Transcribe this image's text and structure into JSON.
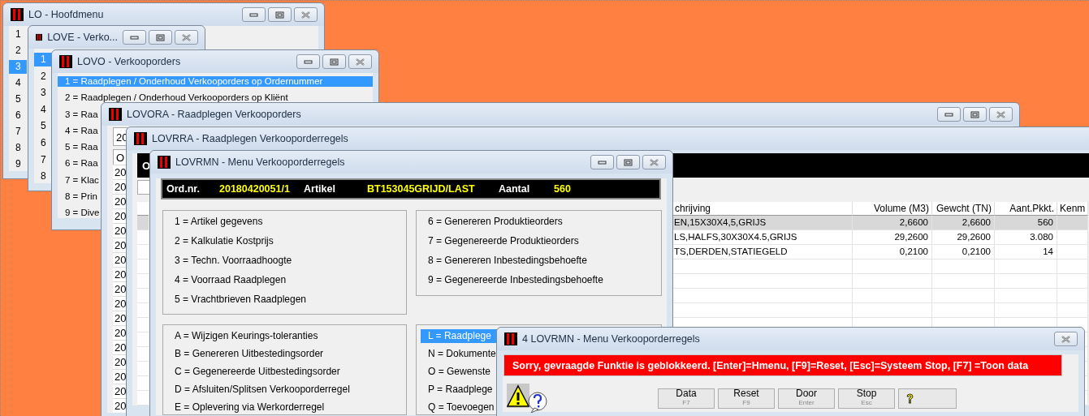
{
  "windows": [
    {
      "kind": "list",
      "title": "LO - Hoofdmenu",
      "items": [
        {
          "label": "1",
          "selected": false
        },
        {
          "label": "2",
          "selected": false
        },
        {
          "label": "3",
          "selected": true
        },
        {
          "label": "4",
          "selected": false
        },
        {
          "label": "5",
          "selected": false
        },
        {
          "label": "6",
          "selected": false
        },
        {
          "label": "7",
          "selected": false
        },
        {
          "label": "8",
          "selected": false
        },
        {
          "label": "9",
          "selected": false
        }
      ]
    },
    {
      "kind": "list",
      "title": "LOVE - Verko...",
      "items": [
        {
          "label": "1",
          "selected": true
        },
        {
          "label": "2",
          "selected": false
        },
        {
          "label": "3",
          "selected": false
        },
        {
          "label": "4",
          "selected": false
        },
        {
          "label": "5",
          "selected": false
        },
        {
          "label": "6",
          "selected": false
        },
        {
          "label": "7",
          "selected": false
        },
        {
          "label": "8",
          "selected": false
        }
      ]
    },
    {
      "kind": "list",
      "title": "LOVO - Verkooporders",
      "items": [
        {
          "label": "1 = Raadplegen / Onderhoud Verkooporders op Ordernummer",
          "selected": true
        },
        {
          "label": "2 = Raadplegen / Onderhoud Verkooporders op Kliënt",
          "selected": false
        },
        {
          "label": "3 = Raa",
          "selected": false
        },
        {
          "label": "4 = Raa",
          "selected": false
        },
        {
          "label": "5 = Raa",
          "selected": false
        },
        {
          "label": "6 = Raa",
          "selected": false
        },
        {
          "label": "7 = Klac",
          "selected": false
        },
        {
          "label": "8 = Prin",
          "selected": false
        },
        {
          "label": "9 = Dive",
          "selected": false
        }
      ]
    },
    {
      "kind": "orders",
      "title": "LOVORA - Raadplegen Verkooporders",
      "field_value": "20",
      "column_1": "O",
      "rows": [
        "20",
        "20",
        "20",
        "20",
        "20",
        "20",
        "20",
        "20",
        "20",
        "20",
        "20",
        "20",
        "20",
        "20",
        "20",
        "20",
        "20"
      ]
    },
    {
      "kind": "lines",
      "title": "LOVRRA - Raadplegen Verkooporderregels",
      "header_bar": "O",
      "columns": [
        "chrijving",
        "Volume (M3)",
        "Gewcht (TN)",
        "Aant.Pkkt.",
        "Kenm"
      ],
      "rows": [
        {
          "cells": [
            "EN,15X30X4,5,GRIJS",
            "2,6600",
            "2,6600",
            "560"
          ],
          "selected": true
        },
        {
          "cells": [
            "LS,HALFS,30X30X4.5,GRIJS",
            "29,2600",
            "29,2600",
            "3.080"
          ],
          "selected": false
        },
        {
          "cells": [
            "TS,DERDEN,STATIEGELD",
            "0,2100",
            "0,2100",
            "14"
          ],
          "selected": false
        }
      ]
    },
    {
      "kind": "menu",
      "title": "LOVRMN - Menu Verkooporderregels",
      "info": [
        {
          "label": "Ord.nr.",
          "value": "20180420051/1"
        },
        {
          "label": "Artikel",
          "value": "BT153045GRIJD/LAST"
        },
        {
          "label": "Aantal",
          "value": "560"
        }
      ],
      "groups": [
        {
          "items": [
            {
              "label": "1 = Artikel gegevens",
              "selected": false
            },
            {
              "label": "2 = Kalkulatie Kostprijs",
              "selected": false
            },
            {
              "label": "3 = Techn. Voorraadhoogte",
              "selected": false
            },
            {
              "label": "4 = Voorraad Raadplegen",
              "selected": false
            },
            {
              "label": "5 = Vrachtbrieven Raadplegen",
              "selected": false
            }
          ]
        },
        {
          "items": [
            {
              "label": "6 = Genereren Produktieorders",
              "selected": false
            },
            {
              "label": "7 = Gegenereerde Produktieorders",
              "selected": false
            },
            {
              "label": "8 = Genereren Inbestedingsbehoefte",
              "selected": false
            },
            {
              "label": "9 = Gegenereerde Inbestedingsbehoefte",
              "selected": false
            }
          ]
        },
        {
          "items": [
            {
              "label": "A = Wijzigen Keurings-toleranties",
              "selected": false
            },
            {
              "label": "B = Genereren Uitbestedingsorder",
              "selected": false
            },
            {
              "label": "C = Gegenereerde Uitbestedingsorder",
              "selected": false
            },
            {
              "label": "D = Afsluiten/Splitsen Verkooporderregel",
              "selected": false
            },
            {
              "label": "E = Oplevering via Werkorderregel",
              "selected": false
            }
          ]
        },
        {
          "items": [
            {
              "label": "L = Raadplege",
              "selected": true
            },
            {
              "label": "N = Dokumente",
              "selected": false
            },
            {
              "label": "O = Gewenste",
              "selected": false
            },
            {
              "label": "P = Raadplege",
              "selected": false
            },
            {
              "label": "Q = Toevoegen",
              "selected": false
            }
          ]
        }
      ]
    },
    {
      "kind": "dialog",
      "title": "4 LOVRMN - Menu Verkooporderregels",
      "message": "Sorry, gevraagde Funktie is geblokkeerd.  [Enter]=Hmenu, [F9]=Reset, [Esc]=Systeem Stop, [F7] =Toon data",
      "buttons": [
        {
          "kind": "key",
          "label": "Data",
          "key": "F7"
        },
        {
          "kind": "key",
          "label": "Reset",
          "key": "F9"
        },
        {
          "kind": "key",
          "label": "Door",
          "key": "Enter"
        },
        {
          "kind": "key",
          "label": "Stop",
          "key": "Esc"
        },
        {
          "kind": "help"
        }
      ]
    }
  ]
}
